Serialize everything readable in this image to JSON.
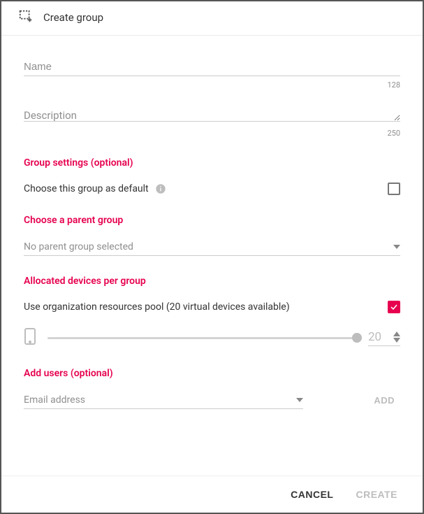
{
  "header": {
    "title": "Create group"
  },
  "fields": {
    "name": {
      "placeholder": "Name",
      "counter": "128"
    },
    "description": {
      "placeholder": "Description",
      "counter": "250"
    }
  },
  "sections": {
    "group_settings": {
      "title": "Group settings (optional)",
      "default_label": "Choose this group as default",
      "default_checked": false
    },
    "parent_group": {
      "title": "Choose a parent group",
      "placeholder": "No parent group selected"
    },
    "allocated": {
      "title": "Allocated devices per group",
      "pool_label": "Use organization resources pool (20 virtual devices available)",
      "pool_checked": true,
      "slider_value": "20"
    },
    "add_users": {
      "title": "Add users (optional)",
      "email_placeholder": "Email address",
      "add_label": "ADD"
    }
  },
  "footer": {
    "cancel": "CANCEL",
    "create": "CREATE"
  }
}
